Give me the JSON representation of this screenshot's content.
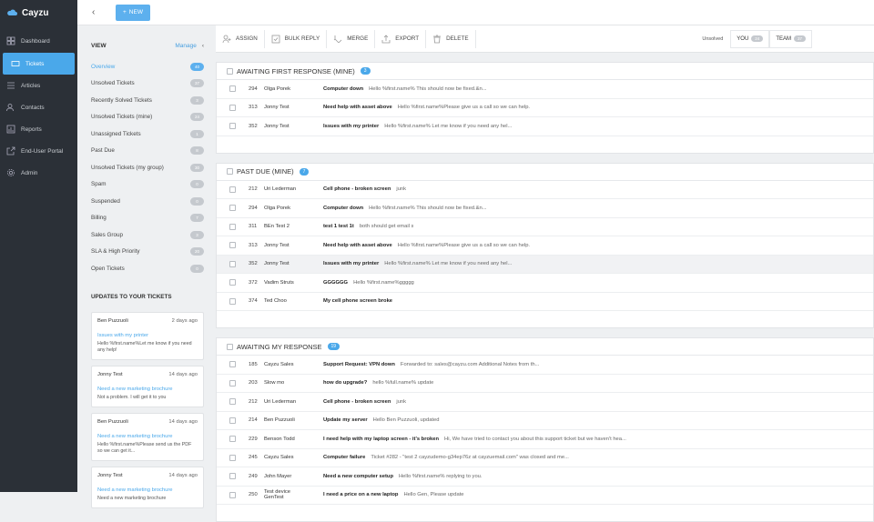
{
  "app": {
    "brand": "Cayzu"
  },
  "sidebar": {
    "items": [
      {
        "label": "Dashboard",
        "icon": "grid-icon"
      },
      {
        "label": "Tickets",
        "icon": "ticket-icon",
        "active": true
      },
      {
        "label": "Articles",
        "icon": "list-icon"
      },
      {
        "label": "Contacts",
        "icon": "users-icon"
      },
      {
        "label": "Reports",
        "icon": "bar-chart-icon"
      },
      {
        "label": "End-User Portal",
        "icon": "external-link-icon"
      },
      {
        "label": "Admin",
        "icon": "gear-icon"
      }
    ]
  },
  "topbar": {
    "new_label": "NEW"
  },
  "views": {
    "heading": "VIEW",
    "manage": "Manage",
    "items": [
      {
        "label": "Overview",
        "count": "40",
        "active": true
      },
      {
        "label": "Unsolved Tickets",
        "count": "37"
      },
      {
        "label": "Recently Solved Tickets",
        "count": "3"
      },
      {
        "label": "Unsolved Tickets (mine)",
        "count": "24"
      },
      {
        "label": "Unassigned Tickets",
        "count": "1"
      },
      {
        "label": "Past Due",
        "count": "8"
      },
      {
        "label": "Unsolved Tickets (my group)",
        "count": "30"
      },
      {
        "label": "Spam",
        "count": "0"
      },
      {
        "label": "Suspended",
        "count": "0"
      },
      {
        "label": "Billing",
        "count": "7"
      },
      {
        "label": "Sales Group",
        "count": "3"
      },
      {
        "label": "SLA & High Priority",
        "count": "20"
      },
      {
        "label": "Open Tickets",
        "count": "0"
      }
    ]
  },
  "updates": {
    "heading": "UPDATES TO YOUR TICKETS",
    "cards": [
      {
        "name": "Ben Puzzuoli",
        "ago": "2 days ago",
        "subject": "Issues with my printer",
        "body": "Hello %first.name%Let me know if you need any help!"
      },
      {
        "name": "Jonny Test",
        "ago": "14 days ago",
        "subject": "Need a new marketing brochure",
        "body": "Not a problem. I will get it to you"
      },
      {
        "name": "Ben Puzzuoli",
        "ago": "14 days ago",
        "subject": "Need a new marketing brochure",
        "body": "Hello %first.name%Please send us the PDF so we can get it..."
      },
      {
        "name": "Jonny Test",
        "ago": "14 days ago",
        "subject": "Need a new marketing brochure",
        "body": "Need a new marketing brochure"
      }
    ]
  },
  "toolbar": {
    "assign": "ASSIGN",
    "bulk_reply": "BULK REPLY",
    "merge": "MERGE",
    "export": "EXPORT",
    "delete": "DELETE",
    "unsolved": "Unsolved",
    "you": "YOU",
    "you_count": "24",
    "team": "TEAM",
    "team_count": "37"
  },
  "groups": [
    {
      "title": "AWAITING FIRST RESPONSE (MINE)",
      "count": "3",
      "rows": [
        {
          "id": "294",
          "name": "Olga Porek",
          "subject": "Computer down",
          "preview": "Hello %first.name% This should now be fixed.&n..."
        },
        {
          "id": "313",
          "name": "Jonny Test",
          "subject": "Need help with asset above",
          "preview": "Hello %first.name%Please give us a call so we can help."
        },
        {
          "id": "352",
          "name": "Jonny Test",
          "subject": "Issues with my printer",
          "preview": "Hello %first.name% Let me know if you need any hel..."
        }
      ]
    },
    {
      "title": "PAST DUE (MINE)",
      "count": "7",
      "rows": [
        {
          "id": "212",
          "name": "Uri Lederman",
          "subject": "Cell phone - broken screen",
          "preview": "junk"
        },
        {
          "id": "294",
          "name": "Olga Porek",
          "subject": "Computer down",
          "preview": "Hello %first.name% This should now be fixed.&n..."
        },
        {
          "id": "311",
          "name": "BEn Test 2",
          "subject": "test 1 test 1t",
          "preview": "both should get email s"
        },
        {
          "id": "313",
          "name": "Jonny Test",
          "subject": "Need help with asset above",
          "preview": "Hello %first.name%Please give us a call so we can help."
        },
        {
          "id": "352",
          "name": "Jonny Test",
          "subject": "Issues with my printer",
          "preview": "Hello %first.name% Let me know if you need any hel...",
          "highlight": true
        },
        {
          "id": "372",
          "name": "Vadim Struts",
          "subject": "GGGGGG",
          "preview": "Hello %first.name%ggggg"
        },
        {
          "id": "374",
          "name": "Ted Choo",
          "subject": "My cell phone screen broke",
          "preview": ""
        }
      ]
    },
    {
      "title": "AWAITING MY RESPONSE",
      "count": "19",
      "rows": [
        {
          "id": "185",
          "name": "Cayzu Sales",
          "subject": "Support Request: VPN down",
          "preview": "Forwarded to: sales@cayzu.com Additional Notes from th..."
        },
        {
          "id": "203",
          "name": "Slow mo",
          "subject": "how do upgrade?",
          "preview": "hello %full.name% update"
        },
        {
          "id": "212",
          "name": "Uri Lederman",
          "subject": "Cell phone - broken screen",
          "preview": "junk"
        },
        {
          "id": "214",
          "name": "Ben Puzzuoli",
          "subject": "Update my server",
          "preview": "Hello Ben Puzzuoli, updated"
        },
        {
          "id": "229",
          "name": "Benson Todd",
          "subject": "I need help with my laptop screen - it's broken",
          "preview": "Hi, We have tried to contact you about this support ticket but we haven't hea..."
        },
        {
          "id": "245",
          "name": "Cayzu Sales",
          "subject": "Computer failure",
          "preview": "Ticket #282 - \"test 2 cayzudemo-g34ep76z at cayzuemail.com\" was closed and me..."
        },
        {
          "id": "249",
          "name": "John Mayer",
          "subject": "Need a new computer setup",
          "preview": "Hello %first.name% replying to you."
        },
        {
          "id": "250",
          "name": "Test device GenTest",
          "subject": "I need a price on a new laptop",
          "preview": "Hello Gen, Please update"
        }
      ]
    }
  ]
}
